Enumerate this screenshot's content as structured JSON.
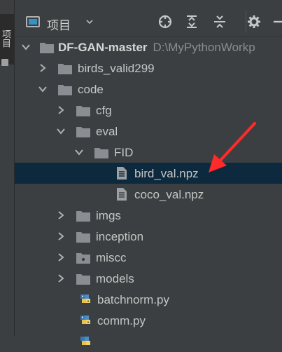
{
  "sidebar": {
    "vertical_text": "项目"
  },
  "header": {
    "title": "项目",
    "toolbar": {
      "locate_icon": "crosshair-icon",
      "expand_icon": "expand-all-icon",
      "collapse_icon": "collapse-all-icon",
      "settings_icon": "gear-icon",
      "hide_icon": "minimize-icon"
    }
  },
  "tree": {
    "root": {
      "label": "DF-GAN-master",
      "path": "D:\\MyPythonWorkp"
    },
    "items": [
      {
        "label": "birds_valid299",
        "type": "folder",
        "state": "collapsed"
      },
      {
        "label": "code",
        "type": "folder",
        "state": "expanded"
      },
      {
        "label": "cfg",
        "type": "folder",
        "state": "collapsed"
      },
      {
        "label": "eval",
        "type": "folder",
        "state": "expanded"
      },
      {
        "label": "FID",
        "type": "folder",
        "state": "expanded"
      },
      {
        "label": "bird_val.npz",
        "type": "file",
        "selected": true
      },
      {
        "label": "coco_val.npz",
        "type": "file"
      },
      {
        "label": "imgs",
        "type": "folder",
        "state": "collapsed"
      },
      {
        "label": "inception",
        "type": "folder",
        "state": "collapsed"
      },
      {
        "label": "miscc",
        "type": "folder",
        "state": "collapsed"
      },
      {
        "label": "models",
        "type": "folder",
        "state": "collapsed"
      },
      {
        "label": "batchnorm.py",
        "type": "python"
      },
      {
        "label": "comm.py",
        "type": "python"
      }
    ]
  },
  "colors": {
    "background": "#3c3f41",
    "selection": "#0d293e",
    "folder": "#8a8e92",
    "annotation_arrow": "#ff2a2a"
  }
}
